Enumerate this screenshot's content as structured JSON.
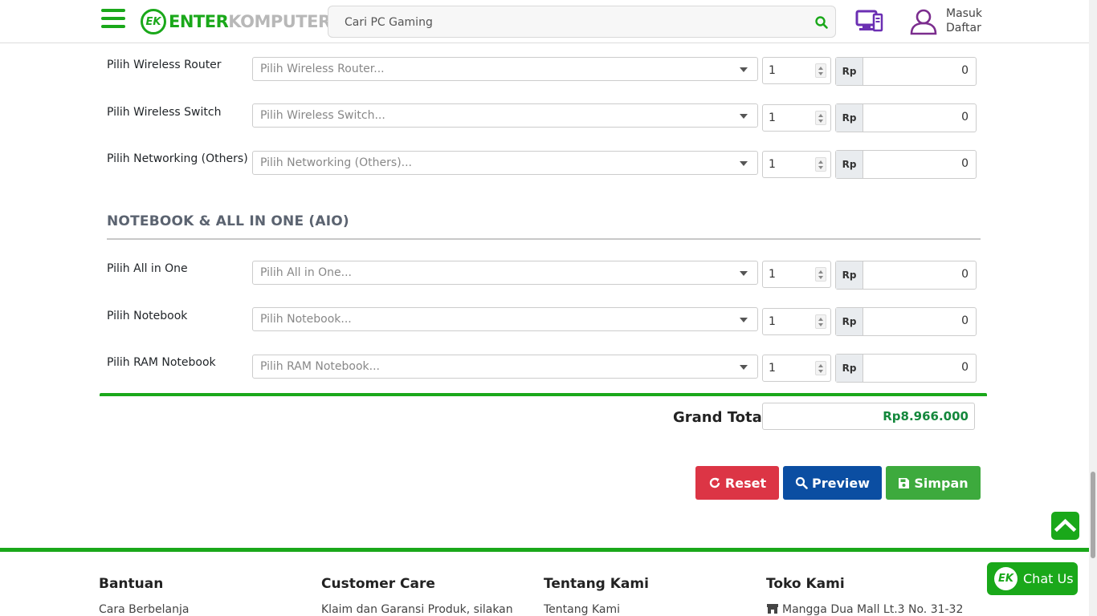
{
  "header": {
    "logo_mark": "EK",
    "logo_enter": "ENTER",
    "logo_komputer": "KOMPUTER",
    "search_placeholder": "Cari PC Gaming",
    "login_label": "Masuk",
    "register_label": "Daftar"
  },
  "network_rows": [
    {
      "label": "Pilih Wireless Router",
      "placeholder": "Pilih Wireless Router...",
      "qty": "1",
      "currency": "Rp",
      "price": "0"
    },
    {
      "label": "Pilih Wireless Switch",
      "placeholder": "Pilih Wireless Switch...",
      "qty": "1",
      "currency": "Rp",
      "price": "0"
    },
    {
      "label": "Pilih Networking (Others)",
      "placeholder": "Pilih Networking (Others)...",
      "qty": "1",
      "currency": "Rp",
      "price": "0"
    }
  ],
  "section_title": "NOTEBOOK & ALL IN ONE (AIO)",
  "notebook_rows": [
    {
      "label": "Pilih All in One",
      "placeholder": "Pilih All in One...",
      "qty": "1",
      "currency": "Rp",
      "price": "0"
    },
    {
      "label": "Pilih Notebook",
      "placeholder": "Pilih Notebook...",
      "qty": "1",
      "currency": "Rp",
      "price": "0"
    },
    {
      "label": "Pilih RAM Notebook",
      "placeholder": "Pilih RAM Notebook...",
      "qty": "1",
      "currency": "Rp",
      "price": "0"
    }
  ],
  "grand_total": {
    "label": "Grand Total",
    "value": "Rp8.966.000"
  },
  "actions": {
    "reset": "Reset",
    "preview": "Preview",
    "simpan": "Simpan"
  },
  "footer": {
    "bantuan": {
      "title": "Bantuan",
      "link": "Cara Berbelanja"
    },
    "customer_care": {
      "title": "Customer Care",
      "link": "Klaim dan Garansi Produk, silakan"
    },
    "tentang": {
      "title": "Tentang Kami",
      "link": "Tentang Kami"
    },
    "toko": {
      "title": "Toko Kami",
      "link": "Mangga Dua Mall Lt.3 No. 31-32"
    }
  },
  "chat": {
    "label": "Chat Us",
    "mark": "EK"
  },
  "colors": {
    "brand_green": "#1aa81a",
    "reset_red": "#dc3545",
    "preview_blue": "#0b4ea2",
    "simpan_green": "#3daa3d",
    "total_green": "#14883c",
    "icon_purple": "#6b2fb3"
  }
}
